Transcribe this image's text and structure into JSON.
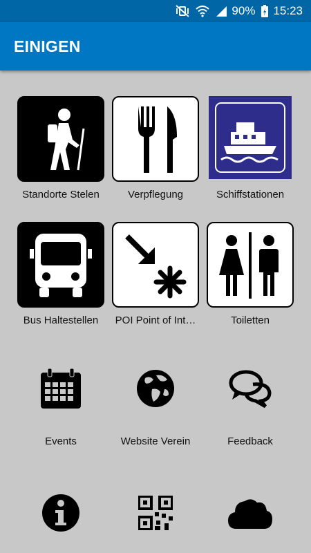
{
  "status_bar": {
    "battery": "90%",
    "time": "15:23"
  },
  "app_bar": {
    "title": "EINIGEN"
  },
  "tiles": [
    {
      "label": "Standorte Stelen",
      "icon": "hiker-icon"
    },
    {
      "label": "Verpflegung",
      "icon": "fork-knife-icon"
    },
    {
      "label": "Schiffstationen",
      "icon": "boat-icon"
    },
    {
      "label": "Bus Haltestellen",
      "icon": "bus-icon"
    },
    {
      "label": "POI Point of Int…",
      "icon": "poi-arrow-icon"
    },
    {
      "label": "Toiletten",
      "icon": "toilets-icon"
    },
    {
      "label": "Events",
      "icon": "calendar-icon"
    },
    {
      "label": "Website Verein",
      "icon": "globe-icon"
    },
    {
      "label": "Feedback",
      "icon": "chat-bubbles-icon"
    },
    {
      "label": "",
      "icon": "info-icon"
    },
    {
      "label": "",
      "icon": "qr-code-icon"
    },
    {
      "label": "",
      "icon": "cloud-icon"
    }
  ]
}
